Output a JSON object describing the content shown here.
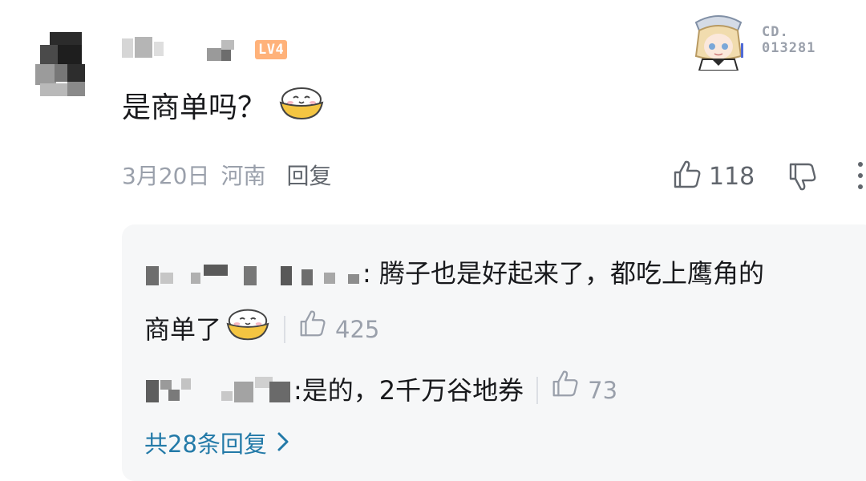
{
  "comment": {
    "level_badge": "LV4",
    "text": "是商单吗？",
    "date": "3月20日",
    "location": "河南",
    "reply_label": "回复",
    "like_count": "118"
  },
  "fan_badge": {
    "number_line1": "CD.",
    "number_line2": "013281"
  },
  "sub_replies": [
    {
      "text_line1": "腾子也是好起来了，都吃上鹰角的",
      "text_line2": "商单了",
      "like_count": "425"
    },
    {
      "text": "是的，2千万谷地券",
      "like_count": "73"
    }
  ],
  "more_replies_label": "共28条回复",
  "colors": {
    "accent_link": "#237aa8",
    "level_badge": "#ffb27a",
    "meta_gray": "#9aa0ab",
    "reply_bg": "#f6f7f8"
  },
  "icons": [
    "thumbs-up-icon",
    "thumbs-down-icon",
    "more-vertical-icon",
    "smiling-bowl-emoji",
    "chevron-right-icon"
  ]
}
